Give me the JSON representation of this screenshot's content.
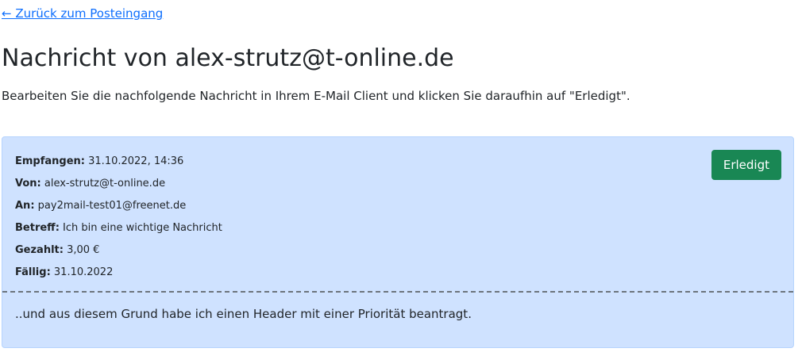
{
  "back_link": "← Zurück zum Posteingang",
  "title": "Nachricht von alex-strutz@t-online.de",
  "instructions": "Bearbeiten Sie die nachfolgende Nachricht in Ihrem E-Mail Client und klicken Sie daraufhin auf \"Erledigt\".",
  "message": {
    "received_label": "Empfangen:",
    "received_value": "31.10.2022, 14:36",
    "from_label": "Von:",
    "from_value": "alex-strutz@t-online.de",
    "to_label": "An:",
    "to_value": "pay2mail-test01@freenet.de",
    "subject_label": "Betreff:",
    "subject_value": "Ich bin eine wichtige Nachricht",
    "paid_label": "Gezahlt:",
    "paid_value": "3,00 €",
    "due_label": "Fällig:",
    "due_value": "31.10.2022",
    "body": "..und aus diesem Grund habe ich einen Header mit einer Priorität beantragt."
  },
  "done_button": "Erledigt",
  "colors": {
    "link": "#0d6efd",
    "card_background": "#cfe2ff",
    "button": "#198754"
  }
}
